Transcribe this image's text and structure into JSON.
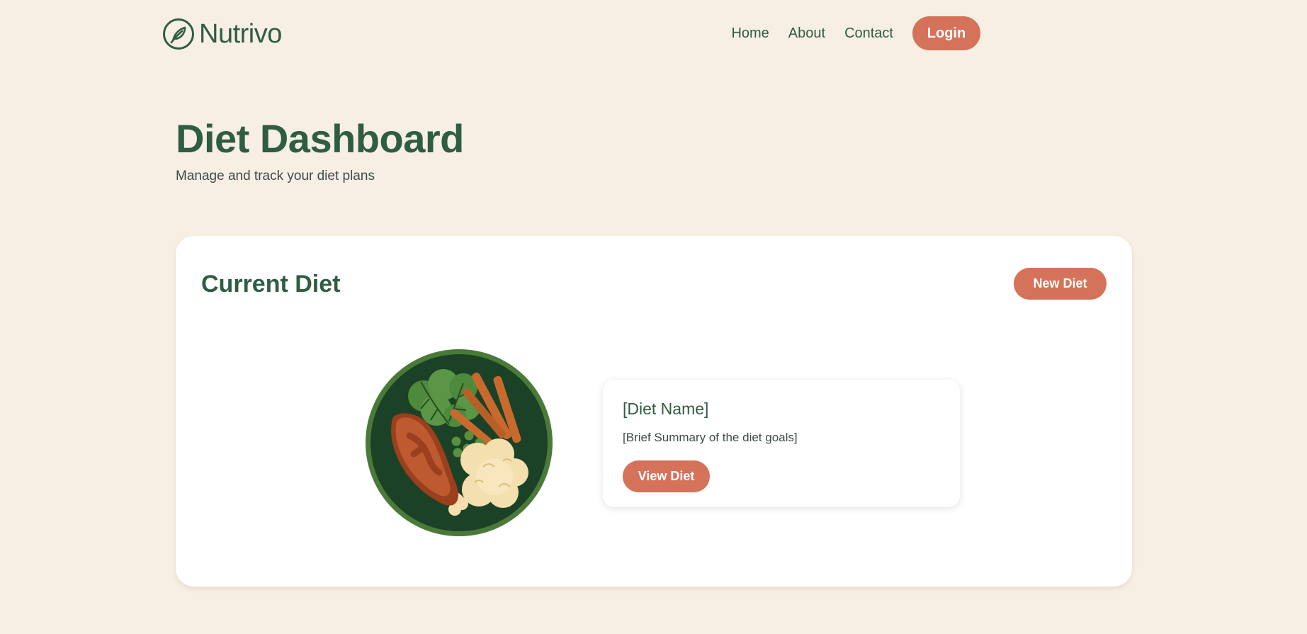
{
  "brand": {
    "name": "Nutrivo",
    "icon": "leaf-icon"
  },
  "nav": {
    "links": [
      "Home",
      "About",
      "Contact"
    ],
    "login_label": "Login"
  },
  "header": {
    "title": "Diet Dashboard",
    "subtitle": "Manage and track your diet plans"
  },
  "current_diet": {
    "title": "Current Diet",
    "new_button_label": "New Diet",
    "image_icon": "food-plate-icon",
    "diet_name": "[Diet Name]",
    "summary": "[Brief Summary of the diet goals]",
    "view_button_label": "View Diet"
  },
  "colors": {
    "background": "#f7efe3",
    "primary_green": "#2f5d42",
    "accent_orange": "#d4735a",
    "card_white": "#ffffff"
  }
}
